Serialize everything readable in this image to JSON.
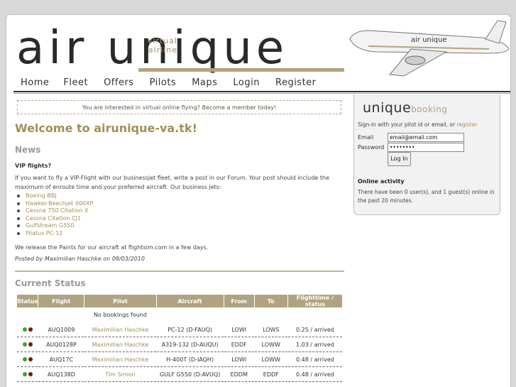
{
  "logo": {
    "main": "air unique",
    "small_1": "virtual",
    "small_2": "airline"
  },
  "nav": [
    "Home",
    "Fleet",
    "Offers",
    "Pilots",
    "Maps",
    "Login",
    "Register"
  ],
  "banner": "You are interested in virtual online flying? Become a member today!",
  "welcome": "Welcome to airunique-va.tk!",
  "news": {
    "heading": "News",
    "title": "VIP flights?",
    "body": "If you want to fly a VIP-Flight with our businessjet fleet, write a post in our Forum. Your post should include the maximum of enroute time and your preferred aircraft. Our business jets:",
    "jets": [
      "Boeing BBJ",
      "Hawker-Beechjet 400XP",
      "Cessna 750 Citation X",
      "Cessna Citation CJ1",
      "Gulfstream G550",
      "Pilatus PC-12"
    ],
    "paints": "We release the Paints for our aircraft at flightsim.com in a few days.",
    "posted": "Posted by Maximilian Haschke on 09/03/2010"
  },
  "status": {
    "heading": "Current Status",
    "columns": [
      "Status",
      "Flight",
      "Pilot",
      "Aircraft",
      "From",
      "To",
      "Flighttime / status"
    ],
    "no_bookings": "No bookings found",
    "rows": [
      {
        "flight": "AUQ1009",
        "pilot": "Maximilian Haschke",
        "aircraft": "PC-12 (D-FAUQ)",
        "from": "LOWI",
        "to": "LOWS",
        "time": "0.25 / arrived"
      },
      {
        "flight": "AUQ0128P",
        "pilot": "Maximilian Haschke",
        "aircraft": "A319-132 (D-AUQU)",
        "from": "EDDF",
        "to": "LOWW",
        "time": "1.03 / arrived"
      },
      {
        "flight": "AUQ17C",
        "pilot": "Maximilian Haschke",
        "aircraft": "H-400T (D-IAQH)",
        "from": "LOWI",
        "to": "LOWW",
        "time": "0.48 / arrived"
      },
      {
        "flight": "AUQ138D",
        "pilot": "Tim Simon",
        "aircraft": "GULF G550 (D-AVUQ)",
        "from": "EDDM",
        "to": "EDDF",
        "time": "0.48 / arrived"
      }
    ]
  },
  "sidebar": {
    "brand_main": "unique",
    "brand_sub": "booking",
    "signin_text": "Sign-in with your pilot id or email, or ",
    "register_link": "register",
    "email_label": "Email",
    "email_value": "email@email.com",
    "password_label": "Password",
    "password_value": "••••••••",
    "login_button": "Log In",
    "online_heading": "Online activity",
    "online_text": "There have been 0 user(s), and 1 guest(s) online in the past 20 minutes."
  },
  "colors": {
    "accent": "#a09055",
    "table_header": "#b0a381",
    "dot_green": "#3aa52e",
    "dot_red": "#8b1010"
  }
}
